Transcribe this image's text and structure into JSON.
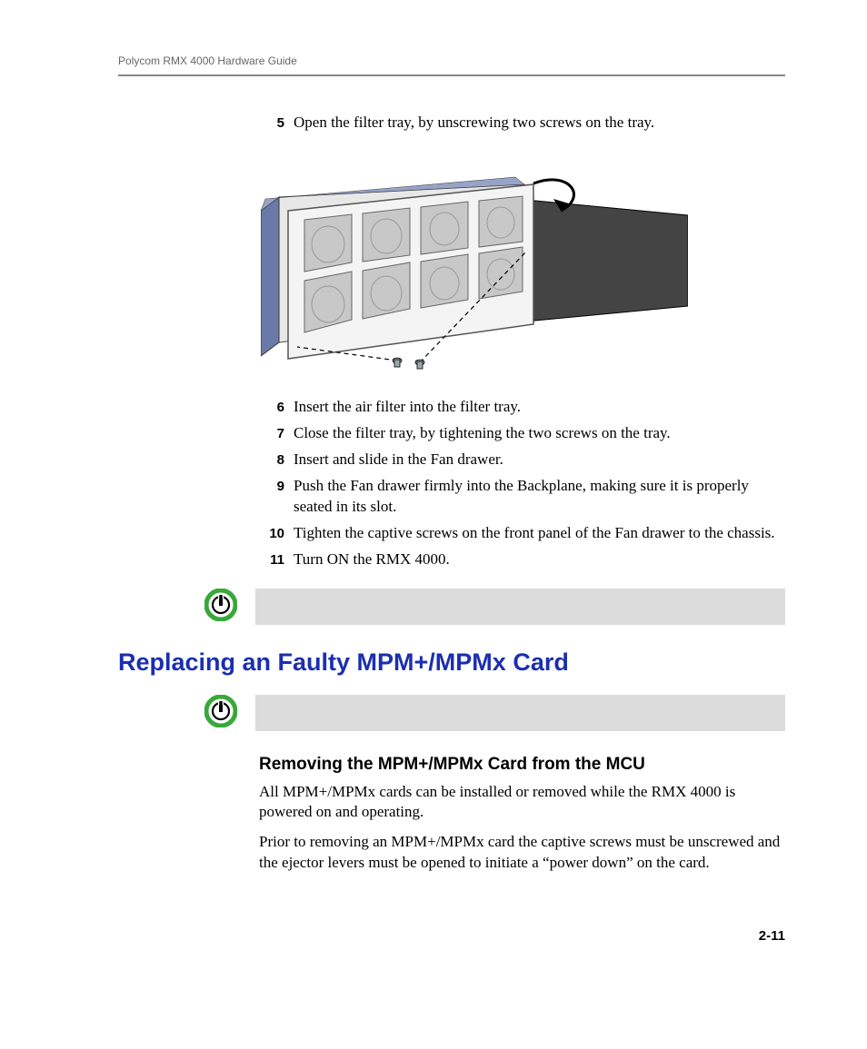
{
  "header": {
    "doc_title": "Polycom RMX 4000 Hardware Guide"
  },
  "steps_a": [
    {
      "num": "5",
      "text": "Open the filter tray, by unscrewing two screws on the tray."
    }
  ],
  "steps_b": [
    {
      "num": "6",
      "text": "Insert the air filter into the filter tray."
    },
    {
      "num": "7",
      "text": "Close the filter tray, by tightening the two screws on the tray."
    },
    {
      "num": "8",
      "text": "Insert and slide in the Fan drawer."
    },
    {
      "num": "9",
      "text": "Push the Fan drawer firmly into the Backplane, making sure it is properly seated in its slot."
    },
    {
      "num": "10",
      "text": "Tighten the captive screws on the front panel of the Fan drawer to the chassis."
    },
    {
      "num": "11",
      "text": "Turn ON the RMX 4000."
    }
  ],
  "section": {
    "title": "Replacing an Faulty MPM+/MPMx Card"
  },
  "subsection": {
    "title": "Removing the MPM+/MPMx Card from the MCU",
    "p1": "All MPM+/MPMx cards can be installed or removed while the RMX 4000 is powered on and operating.",
    "p2": "Prior to removing an MPM+/MPMx card the captive screws must be unscrewed and the ejector levers must be opened to initiate a “power down” on the card."
  },
  "page_number": "2-11"
}
